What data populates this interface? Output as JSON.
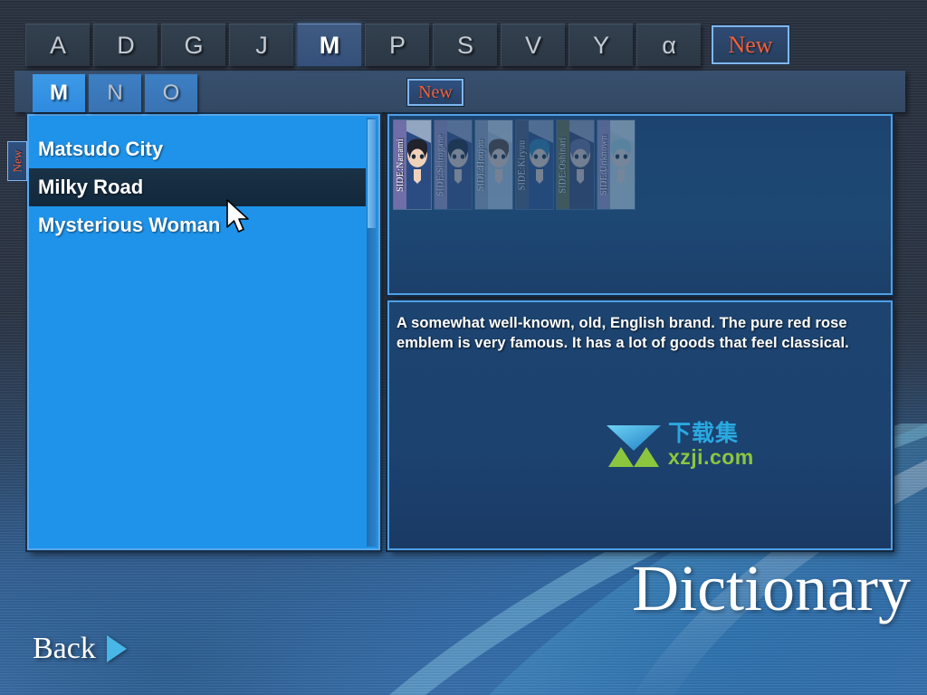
{
  "screen": {
    "title": "Dictionary"
  },
  "letter_tabs": [
    {
      "label": "A",
      "selected": false
    },
    {
      "label": "D",
      "selected": false
    },
    {
      "label": "G",
      "selected": false
    },
    {
      "label": "J",
      "selected": false
    },
    {
      "label": "M",
      "selected": true
    },
    {
      "label": "P",
      "selected": false
    },
    {
      "label": "S",
      "selected": false
    },
    {
      "label": "V",
      "selected": false
    },
    {
      "label": "Y",
      "selected": false
    },
    {
      "label": "α",
      "selected": false
    }
  ],
  "letter_new_button": {
    "label": "New"
  },
  "sub_tabs": [
    {
      "label": "M",
      "selected": true
    },
    {
      "label": "N",
      "selected": false
    },
    {
      "label": "O",
      "selected": false
    }
  ],
  "sub_new_badge": {
    "label": "New"
  },
  "side_new_badge": {
    "label": "New"
  },
  "entry_list": {
    "items": [
      {
        "label": "Matsudo City",
        "selected": false
      },
      {
        "label": "Milky Road",
        "selected": true
      },
      {
        "label": "Mysterious Woman",
        "selected": false
      }
    ]
  },
  "routes": [
    {
      "label": "SIDE:Nanami",
      "active": true,
      "hair": "#20222c",
      "skin": "#f0d2bb",
      "cloth": "#2b4c82",
      "band": "#6f6ea8"
    },
    {
      "label": "SIDE:Shirogane",
      "active": false,
      "hair": "#1d2430",
      "skin": "#ecd0c2",
      "cloth": "#3a4f86",
      "band": "#9d95c4"
    },
    {
      "label": "SIDE:Houjou",
      "active": false,
      "hair": "#5b4438",
      "skin": "#f2d6c4",
      "cloth": "#b6c9de",
      "band": "#9aa7c0"
    },
    {
      "label": "SIDE:Kiryuu",
      "active": false,
      "hair": "#2e7fa8",
      "skin": "#f0d4c0",
      "cloth": "#2f4f86",
      "band": "#4e5a74"
    },
    {
      "label": "SIDE:Oshinari",
      "active": false,
      "hair": "#6a6e94",
      "skin": "#e8cdbc",
      "cloth": "#3d4668",
      "band": "#6e7042"
    },
    {
      "label": "SIDE:Unknown",
      "active": false,
      "hair": "#a9d8dc",
      "skin": "#f0dcd0",
      "cloth": "#c9dfe4",
      "band": "#9d95c4"
    }
  ],
  "description": {
    "text": "A somewhat well-known, old, English brand. The pure red rose emblem is very famous. It has a lot of goods that feel classical."
  },
  "watermark": {
    "cn_text": "下载集",
    "url_text": "xzji.com"
  },
  "back_button": {
    "label": "Back"
  },
  "colors": {
    "accent_blue": "#1f93ea",
    "panel_blue": "#1d4470",
    "new_orange": "#f2603a",
    "border_blue": "#4f9fe4",
    "selected_row": "#12283c"
  }
}
